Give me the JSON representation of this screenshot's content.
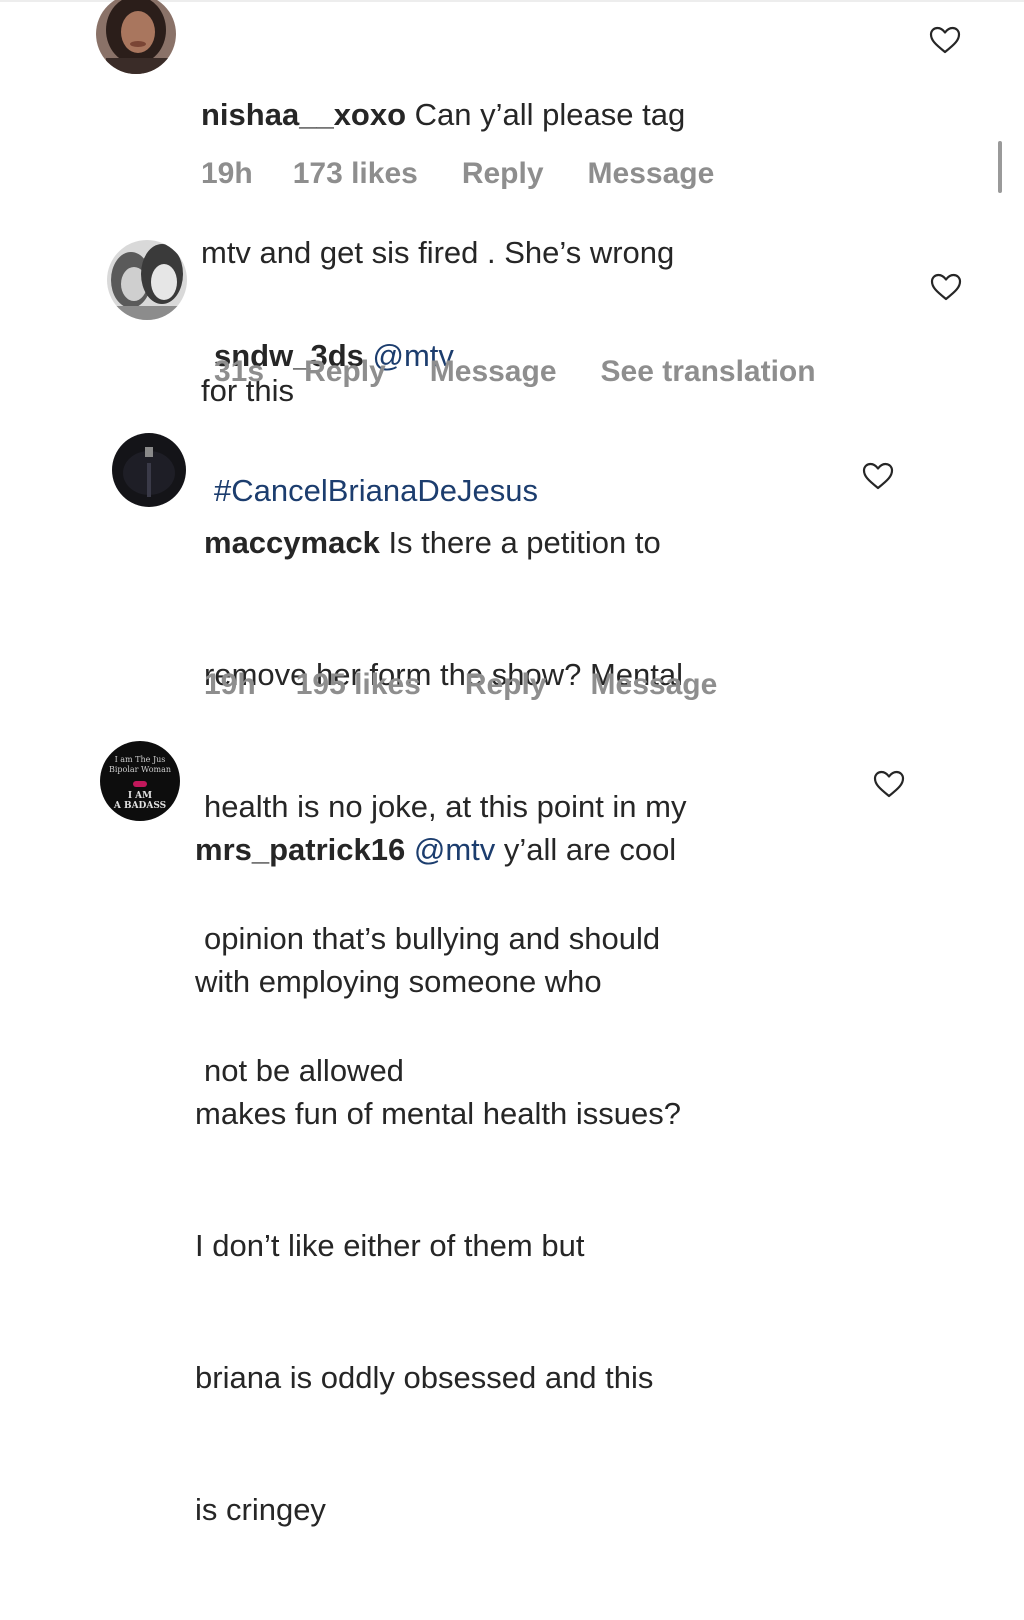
{
  "comments": [
    {
      "username": "nishaa__xoxo",
      "mention": "",
      "text_lines": [
        " Can y’all please tag",
        "mtv and get sis fired . She’s wrong",
        "for this"
      ],
      "time": "19h",
      "likes": "173 likes",
      "reply": "Reply",
      "message": "Message",
      "translate": ""
    },
    {
      "username": "sndw_3ds",
      "mention": " @mtv",
      "text_lines": [
        "",
        "#CancelBrianaDeJesus"
      ],
      "time": "31s",
      "likes": "",
      "reply": "Reply",
      "message": "Message",
      "translate": "See translation"
    },
    {
      "username": "maccymack",
      "mention": "",
      "text_lines": [
        " Is there a petition to",
        "remove her form the show? Mental",
        "health is no joke, at this point in my",
        "opinion that’s bullying and should",
        "not be allowed"
      ],
      "time": "19h",
      "likes": "195 likes",
      "reply": "Reply",
      "message": "Message",
      "translate": ""
    },
    {
      "username": "mrs_patrick16",
      "mention": " @mtv",
      "text_lines": [
        " y’all are cool",
        "with employing someone who",
        "makes fun of mental health issues?",
        "I don’t like either of them but",
        "briana is oddly obsessed and this",
        "is cringey"
      ],
      "time": "",
      "likes": "",
      "reply": "",
      "message": "",
      "translate": ""
    }
  ],
  "avatar4_text": {
    "line1": "I am The Jus",
    "line2": "Bipolar Woman",
    "line3": "I AM",
    "line4": "A BADASS"
  },
  "colors": {
    "text": "#262626",
    "meta": "#8e8e8e",
    "mention": "#1c3d6e",
    "background": "#ffffff"
  },
  "icons": [
    "heart-icon",
    "scroll-indicator"
  ]
}
